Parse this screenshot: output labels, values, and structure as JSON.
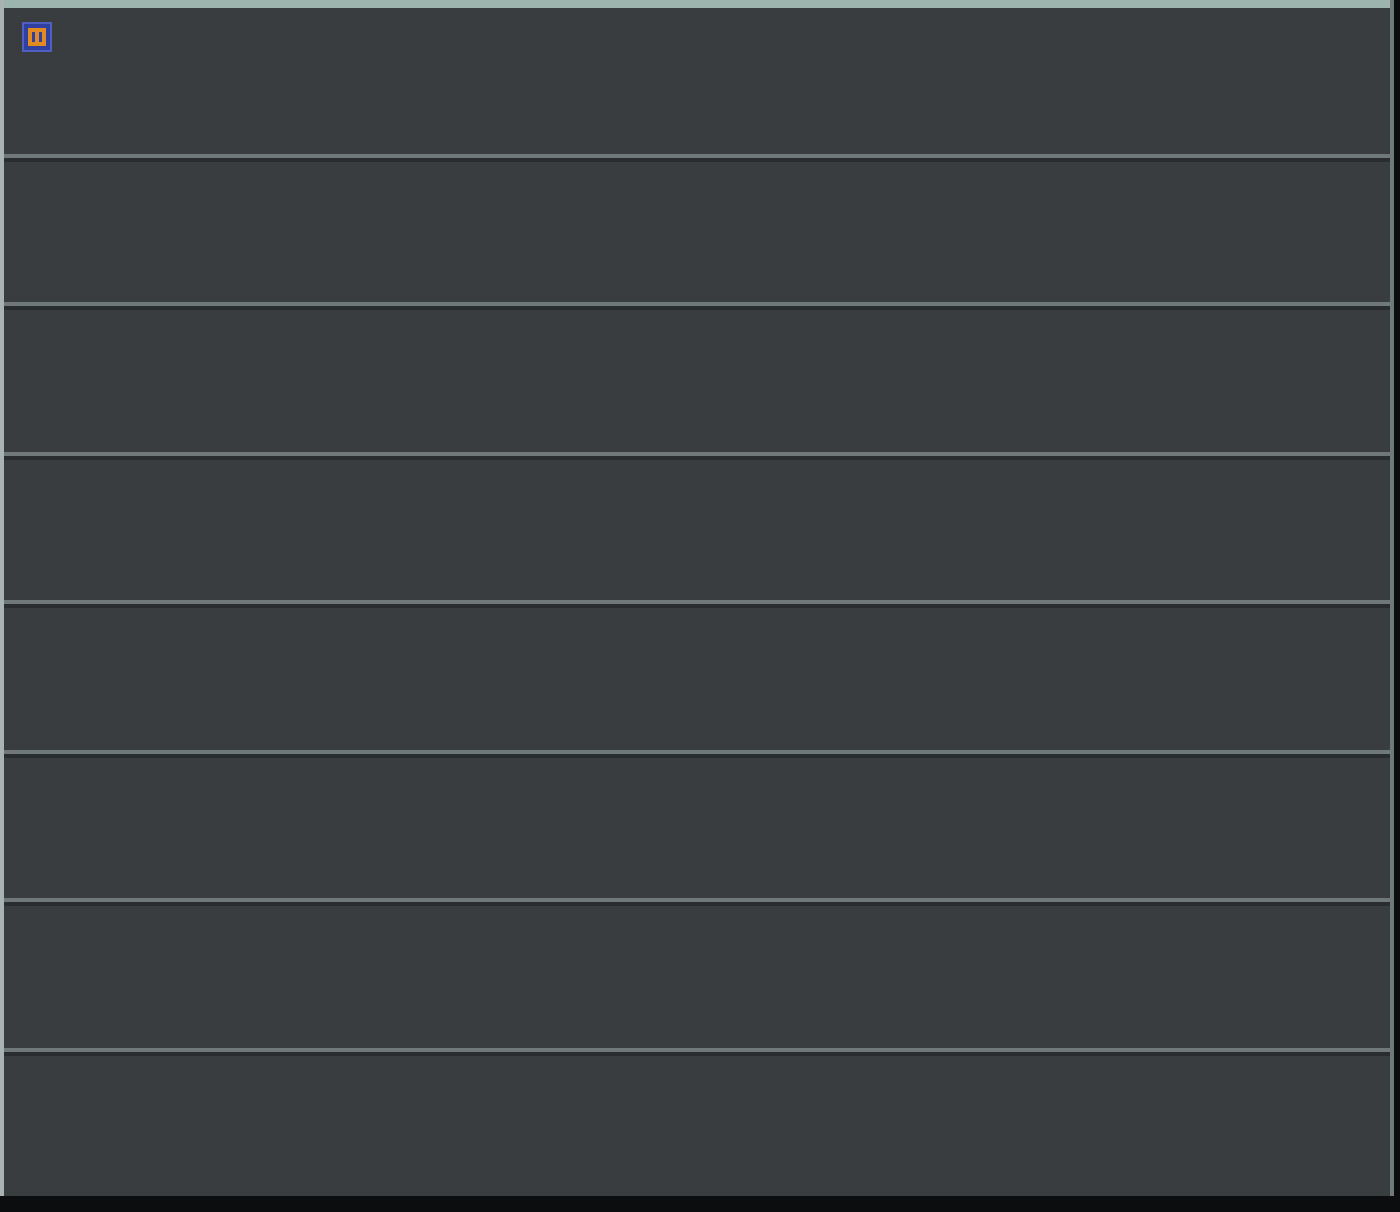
{
  "window": {
    "kind": "app"
  },
  "panels": [
    {
      "kind": "empty"
    },
    {
      "kind": "empty"
    },
    {
      "kind": "empty"
    },
    {
      "kind": "empty"
    },
    {
      "kind": "empty"
    },
    {
      "kind": "empty"
    },
    {
      "kind": "empty"
    },
    {
      "kind": "empty"
    }
  ]
}
